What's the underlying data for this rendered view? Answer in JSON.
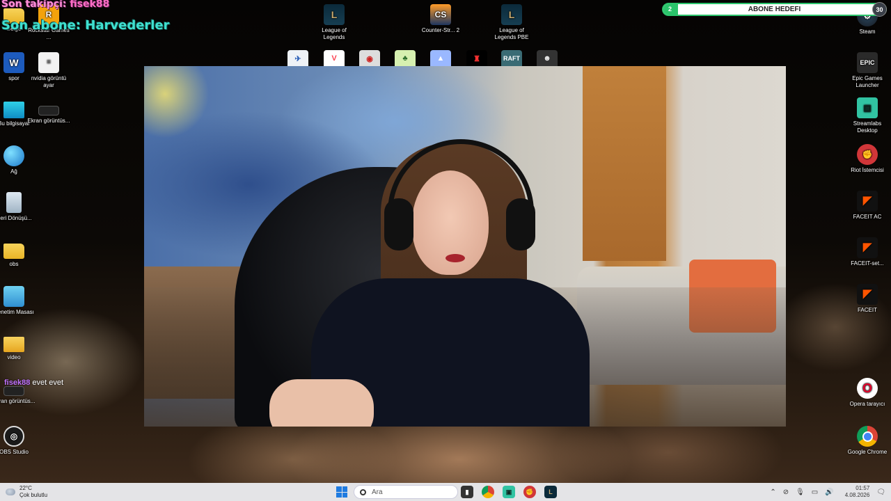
{
  "overlay": {
    "last_follower_prefix": "Son takipçi: ",
    "last_follower_name": "fisek88",
    "last_subscriber": "Son abone: Harvederler",
    "chat_user": "fisek88",
    "chat_message": "evet evet"
  },
  "goal": {
    "label": "ABONE HEDEFI",
    "current": "2",
    "target": "30",
    "progress": 0.067,
    "color": "#2bc46b"
  },
  "desktop_left": [
    {
      "label": "Belge",
      "icon": "folder-icon"
    },
    {
      "label": "Rockstar Games ...",
      "icon": "rockstar-icon"
    },
    {
      "label": "spor",
      "icon": "word-icon"
    },
    {
      "label": "nvidia görüntü ayar",
      "icon": "document-icon"
    },
    {
      "label": "Bu bilgisayar",
      "icon": "monitor-icon"
    },
    {
      "label": "Ekran görüntüs...",
      "icon": "screenshot-icon"
    },
    {
      "label": "Ağ",
      "icon": "network-icon"
    },
    {
      "label": "Geri Dönüşü...",
      "icon": "recycle-bin-icon"
    },
    {
      "label": "obs",
      "icon": "folder-icon"
    },
    {
      "label": "Denetim Masası",
      "icon": "control-panel-icon"
    },
    {
      "label": "video",
      "icon": "folder-icon"
    },
    {
      "label": "Ekran görüntüs...",
      "icon": "screenshot-icon"
    },
    {
      "label": "OBS Studio",
      "icon": "obs-icon"
    }
  ],
  "desktop_top": [
    {
      "label": "League of Legends",
      "icon": "league-icon"
    },
    {
      "label": "Counter-Str... 2",
      "icon": "cs2-icon"
    },
    {
      "label": "League of Legends PBE",
      "icon": "league-icon"
    }
  ],
  "desktop_right": [
    {
      "label": "Steam",
      "icon": "steam-icon"
    },
    {
      "label": "Epic Games Launcher",
      "icon": "epic-icon"
    },
    {
      "label": "Streamlabs Desktop",
      "icon": "streamlabs-icon"
    },
    {
      "label": "Riot İstemcisi",
      "icon": "riot-icon"
    },
    {
      "label": "FACEIT AC",
      "icon": "faceit-icon"
    },
    {
      "label": "FACEIT-set...",
      "icon": "faceit-icon"
    },
    {
      "label": "FACEIT",
      "icon": "faceit-icon"
    },
    {
      "label": "Opera tarayıcı",
      "icon": "opera-icon"
    },
    {
      "label": "Google Chrome",
      "icon": "chrome-icon"
    }
  ],
  "taskbar": {
    "temperature": "22°C",
    "weather": "Çok bulutlu",
    "search_placeholder": "Ara",
    "time": "01:57",
    "date": "4.08.2026"
  }
}
